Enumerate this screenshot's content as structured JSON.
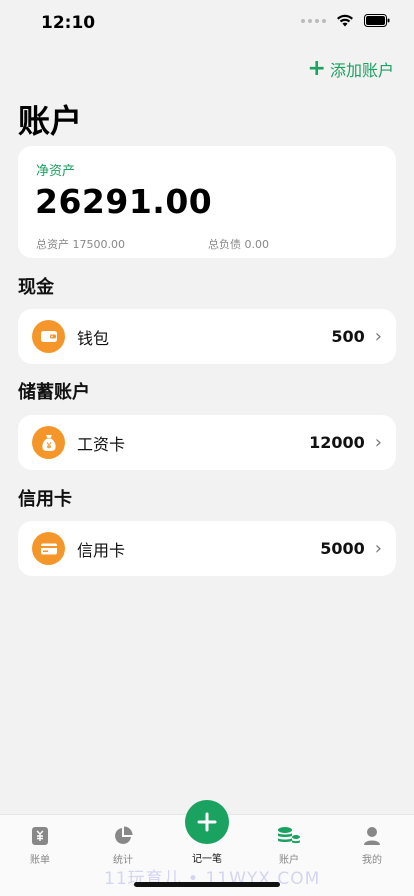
{
  "status_bar": {
    "time": "12:10"
  },
  "header": {
    "add_account_label": "添加账户",
    "title": "账户"
  },
  "net_assets": {
    "label": "净资产",
    "value": "26291.00",
    "total_assets": "总资产 17500.00",
    "total_debts": "总负债 0.00"
  },
  "sections": [
    {
      "title": "现金",
      "items": [
        {
          "name": "钱包",
          "amount": "500",
          "icon": "wallet-icon"
        }
      ]
    },
    {
      "title": "储蓄账户",
      "items": [
        {
          "name": "工资卡",
          "amount": "12000",
          "icon": "money-bag-icon"
        }
      ]
    },
    {
      "title": "信用卡",
      "items": [
        {
          "name": "信用卡",
          "amount": "5000",
          "icon": "credit-card-icon"
        }
      ]
    }
  ],
  "colors": {
    "accent": "#1aa260",
    "account_icon_bg": "#f5962a",
    "background": "#f2f2f2"
  },
  "tabbar": {
    "tabs": [
      {
        "label": "账单",
        "icon": "bill-icon"
      },
      {
        "label": "统计",
        "icon": "pie-chart-icon"
      },
      {
        "label": "记一笔",
        "icon": "plus-icon"
      },
      {
        "label": "账户",
        "icon": "coins-stack-icon",
        "active": true
      },
      {
        "label": "我的",
        "icon": "person-icon"
      }
    ]
  },
  "watermark": "11玩育儿 • 11WYX.COM"
}
